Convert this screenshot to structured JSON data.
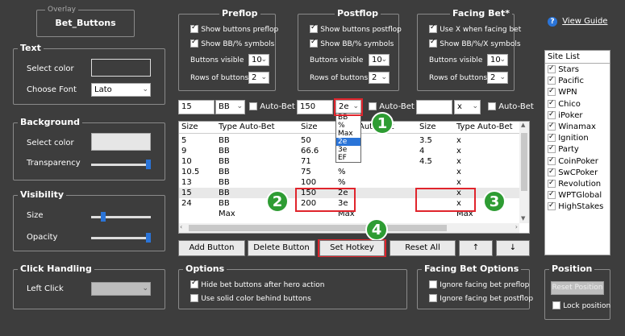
{
  "overlay": {
    "legend": "Overlay",
    "name": "Bet_Buttons"
  },
  "text_section": {
    "legend": "Text",
    "select_color": "Select color",
    "choose_font": "Choose Font",
    "font_value": "Lato"
  },
  "background_section": {
    "legend": "Background",
    "select_color": "Select color",
    "transparency": "Transparency",
    "transparency_level": 1.0
  },
  "visibility_section": {
    "legend": "Visibility",
    "size": "Size",
    "size_level": 0.2,
    "opacity": "Opacity",
    "opacity_level": 1.0
  },
  "click_section": {
    "legend": "Click Handling",
    "left_click": "Left Click"
  },
  "preflop": {
    "legend": "Preflop",
    "cb1": "Show buttons preflop",
    "cb2": "Show BB/% symbols",
    "buttons_visible": "Buttons visible",
    "buttons_visible_val": "10",
    "rows": "Rows of buttons",
    "rows_val": "2"
  },
  "postflop": {
    "legend": "Postflop",
    "cb1": "Show buttons postflop",
    "cb2": "Show BB/% symbols",
    "buttons_visible": "Buttons visible",
    "buttons_visible_val": "10",
    "rows": "Rows of buttons",
    "rows_val": "2"
  },
  "facing": {
    "legend": "Facing Bet*",
    "cb1": "Use X when facing bet",
    "cb2": "Show BB/%/X symbols",
    "buttons_visible": "Buttons visible",
    "buttons_visible_val": "10",
    "rows": "Rows of buttons",
    "rows_val": "2"
  },
  "guide": {
    "label": "View Guide",
    "icon": "?"
  },
  "add_row": {
    "pre_size": "15",
    "pre_type": "BB",
    "auto_bet": "Auto-Bet",
    "post_size": "150",
    "post_type": "2e",
    "facing_type": "x"
  },
  "dropdown": {
    "options": [
      "BB",
      "%",
      "Max",
      "2e",
      "3e",
      "EF"
    ],
    "selected_index": 3
  },
  "table": {
    "headers": [
      "Size",
      "Type",
      "Auto-Bet",
      "Size",
      "Type",
      "Auto-Bet",
      "Size",
      "Type",
      "Auto-Bet"
    ],
    "rows": [
      [
        "5",
        "BB",
        "",
        "50",
        "",
        "",
        "3.5",
        "x",
        ""
      ],
      [
        "9",
        "BB",
        "",
        "66.6",
        "",
        "",
        "4",
        "x",
        ""
      ],
      [
        "10",
        "BB",
        "",
        "71",
        "",
        "",
        "4.5",
        "x",
        ""
      ],
      [
        "10.5",
        "BB",
        "",
        "75",
        "%",
        "",
        "",
        "x",
        ""
      ],
      [
        "13",
        "BB",
        "",
        "100",
        "%",
        "",
        "",
        "x",
        ""
      ],
      [
        "15",
        "BB",
        "",
        "150",
        "2e",
        "",
        "",
        "x",
        ""
      ],
      [
        "24",
        "BB",
        "",
        "200",
        "3e",
        "",
        "",
        "x",
        ""
      ],
      [
        "",
        "Max",
        "",
        "",
        "Max",
        "",
        "",
        "Max",
        ""
      ]
    ]
  },
  "buttons": {
    "add": "Add Button",
    "delete": "Delete Button",
    "hotkey": "Set Hotkey",
    "reset": "Reset All",
    "up": "↑",
    "down": "↓"
  },
  "badges": [
    "1",
    "2",
    "3",
    "4"
  ],
  "options": {
    "legend": "Options",
    "cb1": "Hide bet buttons after hero action",
    "cb2": "Use solid color behind buttons"
  },
  "facing_options": {
    "legend": "Facing Bet Options",
    "cb1": "Ignore facing bet preflop",
    "cb2": "Ignore facing bet postflop"
  },
  "position": {
    "legend": "Position",
    "reset": "Reset Position",
    "lock": "Lock position"
  },
  "sites": {
    "header": "Site List",
    "items": [
      "Stars",
      "Pacific",
      "WPN",
      "Chico",
      "iPoker",
      "Winamax",
      "Ignition",
      "Party",
      "CoinPoker",
      "SwCPoker",
      "Revolution",
      "WPTGlobal",
      "HighStakes"
    ]
  },
  "colors": {
    "accent": "#2a74d8",
    "highlight": "#e0242c",
    "badge": "#2e9c33"
  }
}
